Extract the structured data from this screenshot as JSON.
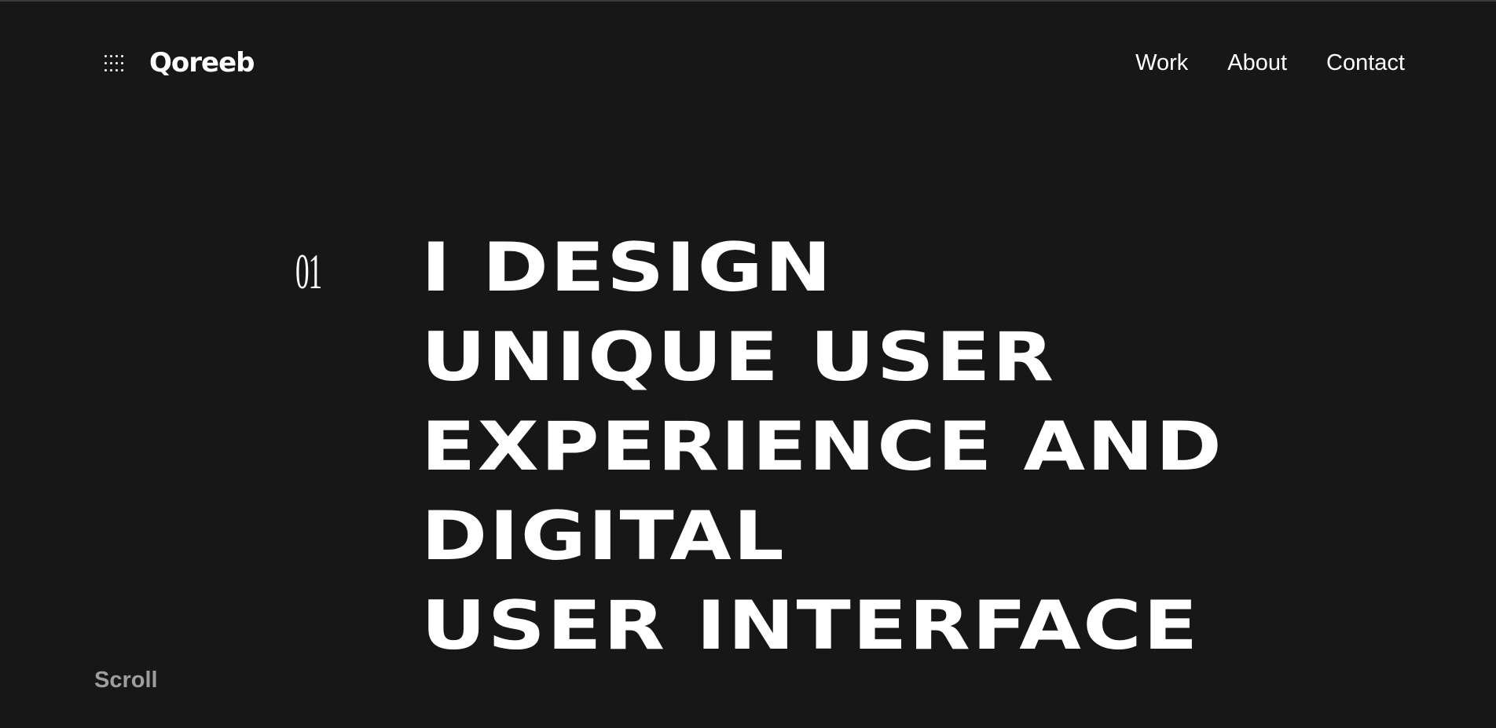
{
  "header": {
    "menu_icon": "dots-grid-icon",
    "logo": "Qoreeb",
    "nav": [
      {
        "label": "Work"
      },
      {
        "label": "About"
      },
      {
        "label": "Contact"
      }
    ]
  },
  "hero": {
    "number": "01",
    "headline_lines": [
      "I DESIGN",
      "UNIQUE USER",
      "EXPERIENCE AND",
      "DIGITAL",
      "USER INTERFACE"
    ]
  },
  "footer": {
    "scroll_label": "Scroll"
  },
  "colors": {
    "background": "#171717",
    "text": "#ffffff",
    "muted": "#9e9e9e"
  }
}
